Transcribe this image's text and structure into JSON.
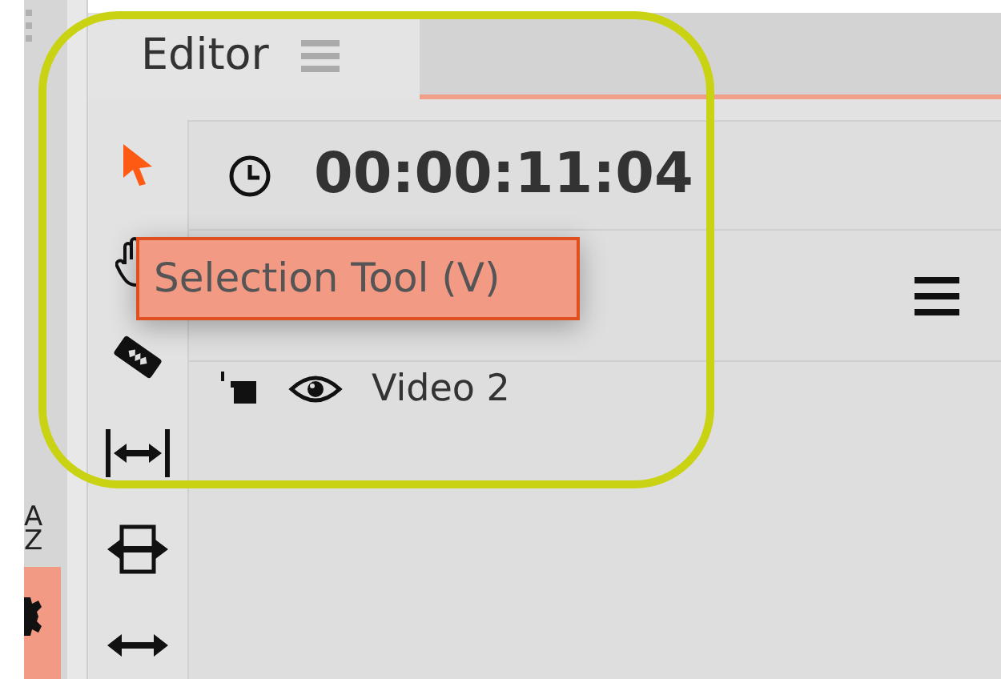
{
  "side_strip": {
    "labels": [
      "A",
      "Z"
    ]
  },
  "tab": {
    "label": "Editor",
    "selected": true
  },
  "tools": [
    {
      "kind": "pointer",
      "selected": true
    },
    {
      "kind": "hand",
      "selected": false
    },
    {
      "kind": "razor",
      "selected": false
    },
    {
      "kind": "fit",
      "selected": false
    },
    {
      "kind": "stretch",
      "selected": false
    },
    {
      "kind": "slide",
      "selected": false
    }
  ],
  "tooltip": {
    "text": "Selection Tool (V)"
  },
  "timecode": "00:00:11:04",
  "tracks": [
    {
      "name": "Video 2",
      "visible": true
    }
  ]
}
